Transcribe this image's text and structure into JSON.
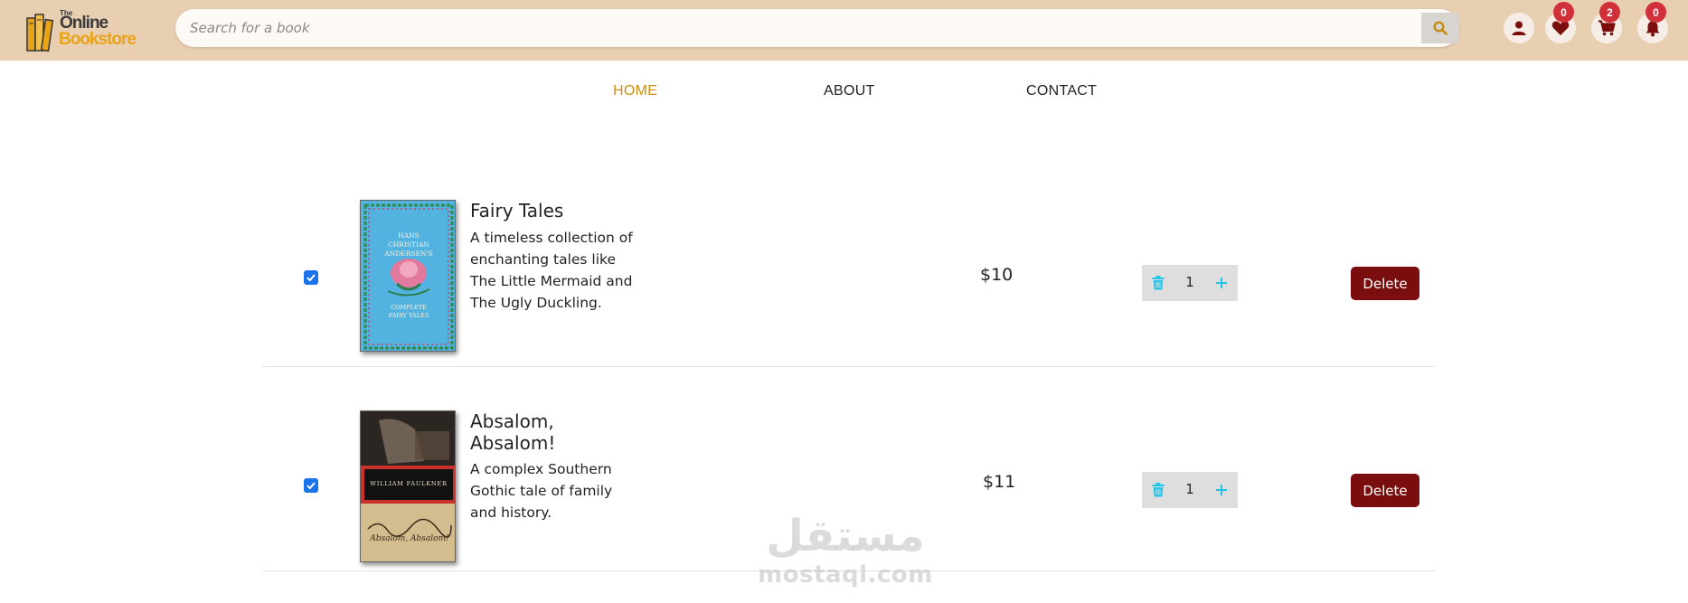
{
  "brand": {
    "the": "The",
    "online": "Online",
    "bookstore": "Bookstore"
  },
  "search": {
    "placeholder": "Search for a book",
    "value": ""
  },
  "header_icons": {
    "user": "user-icon",
    "wishlist": {
      "icon": "heart-icon",
      "count": "0"
    },
    "cart": {
      "icon": "cart-icon",
      "count": "2"
    },
    "notifications": {
      "icon": "bell-icon",
      "count": "0"
    }
  },
  "nav": {
    "home": "HOME",
    "about": "ABOUT",
    "contact": "CONTACT",
    "active": "HOME"
  },
  "cart_items": [
    {
      "checked": true,
      "title": "Fairy Tales",
      "description": "A timeless collection of enchanting tales like The Little Mermaid and The Ugly Duckling.",
      "price": "$10",
      "quantity": "1",
      "delete_label": "Delete",
      "cover_lines": [
        "HANS",
        "CHRISTIAN",
        "ANDERSEN'S",
        "COMPLETE",
        "FAIRY TALES"
      ]
    },
    {
      "checked": true,
      "title": "Absalom, Absalom!",
      "description": "A complex Southern Gothic tale of family and history.",
      "price": "$11",
      "quantity": "1",
      "delete_label": "Delete",
      "cover_lines": [
        "WILLIAM FAULKNER",
        "Absalom, Absalom!"
      ]
    }
  ],
  "watermark": {
    "arabic": "مستقل",
    "latin": "mostaql.com"
  },
  "colors": {
    "header_bg": "#e9cfb1",
    "accent": "#cc8f13",
    "badge": "#d1303a",
    "delete_button": "#7a0d0d",
    "icon_maroon": "#7a0d0d",
    "qty_icon": "#20c4e6"
  }
}
